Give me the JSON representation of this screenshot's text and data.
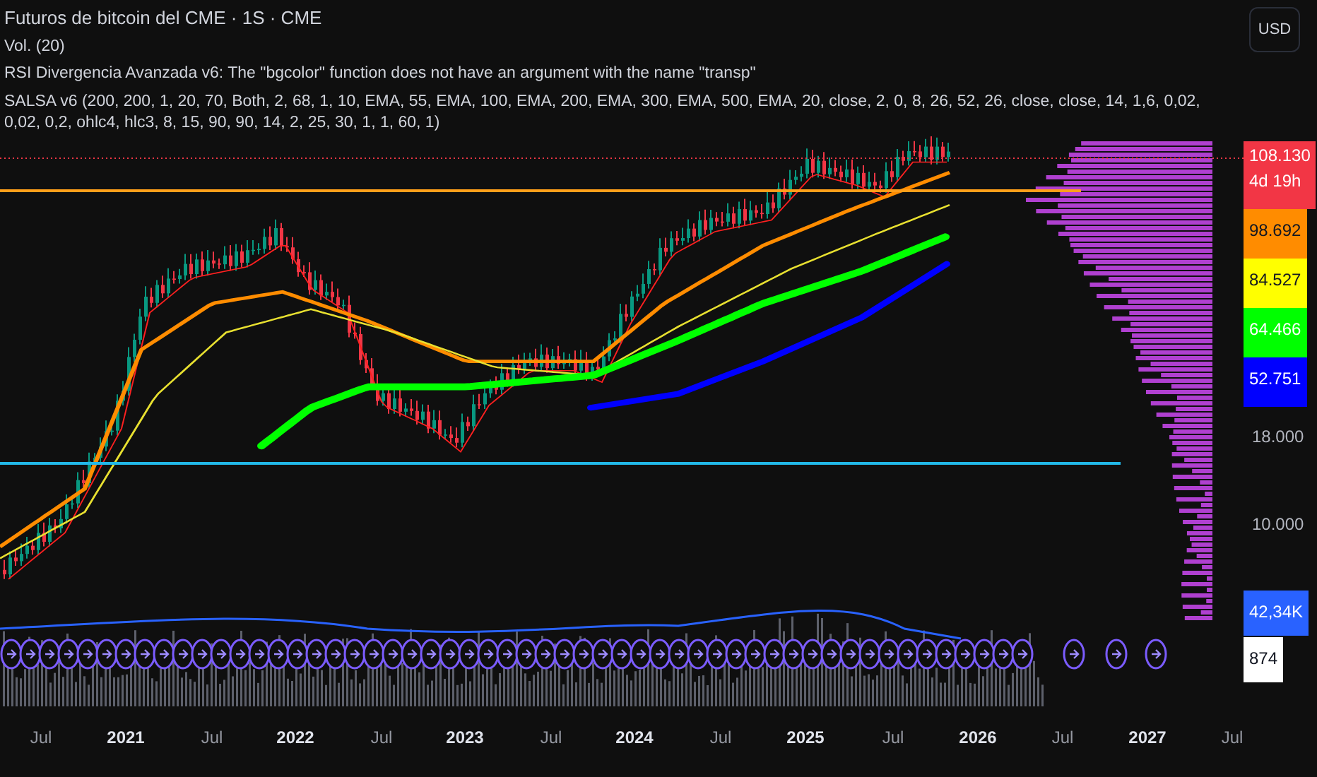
{
  "legend": [
    {
      "text": "Futuros de bitcoin del CME · 1S · CME",
      "kind": "symbol"
    },
    {
      "text": "Vol. (20)",
      "kind": "study"
    },
    {
      "text": "RSI Divergencia Avanzada v6: The \"bgcolor\" function does not have an argument with the name \"transp\"",
      "kind": "study"
    },
    {
      "text": "SALSA v6 (200, 200, 1, 20, 70, Both, 2, 68, 1, 10, EMA, 55, EMA, 100, EMA, 200, EMA, 300, EMA, 500, EMA, 20, close, 2, 0, 8, 26, 52, 26, close, close, 14, 1,6, 0,02, 0,02, 0,2, ohlc4, hlc3, 8, 15, 90, 90, 14, 2, 25, 30, 1, 1, 60, 1)",
      "kind": "study"
    }
  ],
  "price_axis": {
    "currency_button": "USD",
    "labels": [
      {
        "text": "108.130",
        "sub": "4d 19h",
        "color": "#f23645",
        "kind": "price"
      },
      {
        "text": "98.692",
        "color": "#ff8c00",
        "kind": "price"
      },
      {
        "text": "84.527",
        "color": "#ffff00",
        "kind": "price"
      },
      {
        "text": "64.466",
        "color": "#00ff00",
        "kind": "price"
      },
      {
        "text": "52.751",
        "color": "#0000ff",
        "kind": "price"
      },
      {
        "text": "18.000",
        "kind": "tick"
      },
      {
        "text": "10.000",
        "kind": "tick"
      },
      {
        "text": "42,34K",
        "color": "#2962ff",
        "kind": "volume"
      },
      {
        "text": "874",
        "color": "#ffffff",
        "kind": "volume"
      }
    ]
  },
  "time_axis": [
    {
      "text": "Jul",
      "kind": "month"
    },
    {
      "text": "2021",
      "kind": "year"
    },
    {
      "text": "Jul",
      "kind": "month"
    },
    {
      "text": "2022",
      "kind": "year"
    },
    {
      "text": "Jul",
      "kind": "month"
    },
    {
      "text": "2023",
      "kind": "year"
    },
    {
      "text": "Jul",
      "kind": "month"
    },
    {
      "text": "2024",
      "kind": "year"
    },
    {
      "text": "Jul",
      "kind": "month"
    },
    {
      "text": "2025",
      "kind": "year"
    },
    {
      "text": "Jul",
      "kind": "month"
    },
    {
      "text": "2026",
      "kind": "year"
    },
    {
      "text": "Jul",
      "kind": "month"
    },
    {
      "text": "2027",
      "kind": "year"
    },
    {
      "text": "Jul",
      "kind": "month"
    }
  ]
}
